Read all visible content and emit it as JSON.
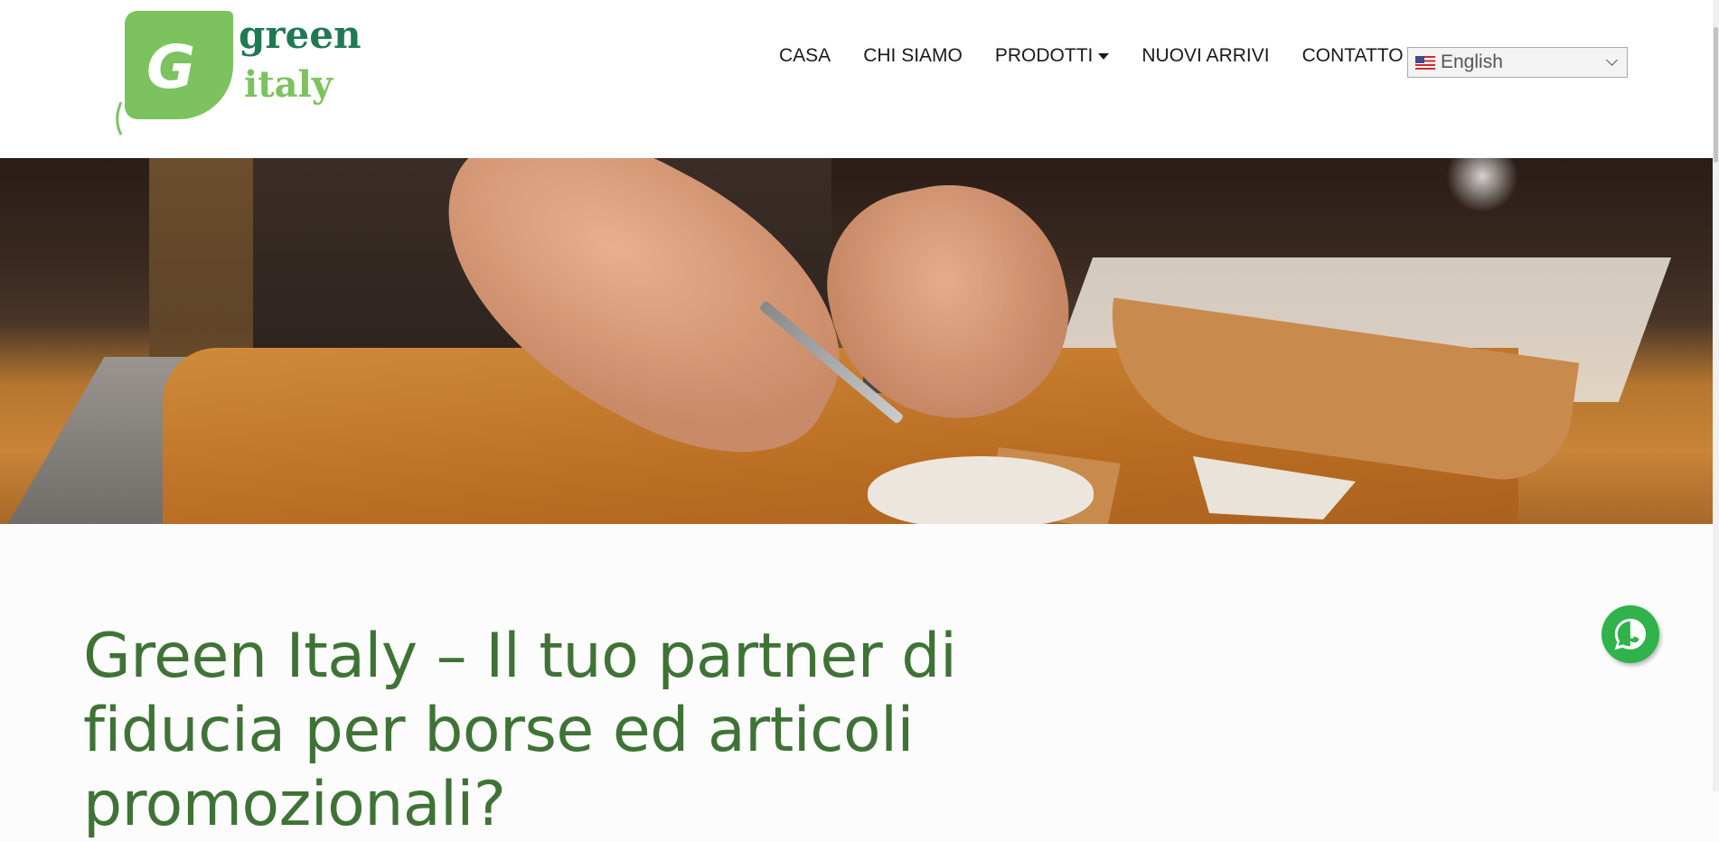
{
  "brand": {
    "logo_text_top": "green",
    "logo_text_bottom": "italy",
    "logo_letter": "G",
    "primary_green": "#3f7336",
    "leaf_green": "#7cc35f",
    "dark_green": "#1f7a52"
  },
  "nav": {
    "items": [
      {
        "label": "CASA"
      },
      {
        "label": "CHI SIAMO"
      },
      {
        "label": "PRODOTTI",
        "has_dropdown": true
      },
      {
        "label": "NUOVI ARRIVI"
      },
      {
        "label": "CONTATTO"
      }
    ]
  },
  "language": {
    "selected": "English",
    "flag_icon": "us-flag-icon"
  },
  "hero": {
    "image_subject": "leather-cutting-workshop"
  },
  "content": {
    "headline": "Green Italy – Il tuo partner di fiducia per borse ed articoli promozionali?"
  },
  "whatsapp": {
    "icon": "whatsapp-icon",
    "color": "#2fb34a"
  }
}
